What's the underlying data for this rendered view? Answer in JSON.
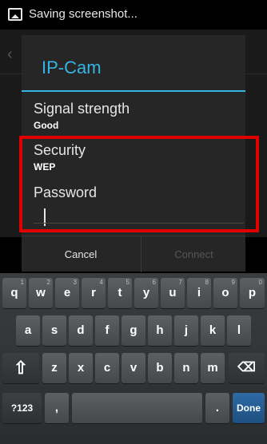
{
  "status_bar": {
    "notification": "Saving screenshot..."
  },
  "dialog": {
    "title": "IP-Cam",
    "fields": [
      {
        "label": "Signal strength",
        "value": "Good"
      },
      {
        "label": "Security",
        "value": "WEP"
      }
    ],
    "password_label": "Password",
    "password_value": "",
    "buttons": {
      "cancel": "Cancel",
      "connect": "Connect"
    }
  },
  "keyboard": {
    "row1": [
      {
        "label": "q",
        "hint": "1"
      },
      {
        "label": "w",
        "hint": "2"
      },
      {
        "label": "e",
        "hint": "3"
      },
      {
        "label": "r",
        "hint": "4"
      },
      {
        "label": "t",
        "hint": "5"
      },
      {
        "label": "y",
        "hint": "6"
      },
      {
        "label": "u",
        "hint": "7"
      },
      {
        "label": "i",
        "hint": "8"
      },
      {
        "label": "o",
        "hint": "9"
      },
      {
        "label": "p",
        "hint": "0"
      }
    ],
    "row2": [
      "a",
      "s",
      "d",
      "f",
      "g",
      "h",
      "j",
      "k",
      "l"
    ],
    "row3": [
      "z",
      "x",
      "c",
      "v",
      "b",
      "n",
      "m"
    ],
    "symbols_label": "?123",
    "comma": ",",
    "period": ".",
    "done_label": "Done"
  }
}
